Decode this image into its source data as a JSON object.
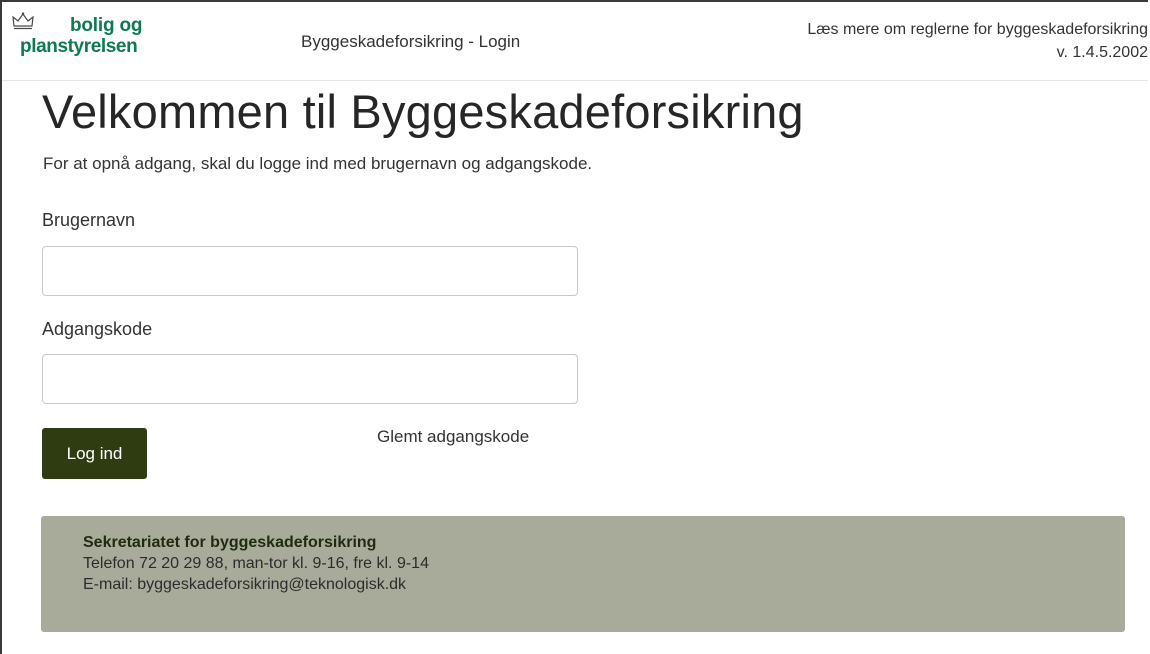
{
  "header": {
    "logo_line1": "bolig og",
    "logo_line2": "planstyrelsen",
    "app_title": "Byggeskadeforsikring - Login",
    "rules_link": "Læs mere om reglerne for byggeskadeforsikring",
    "version": "v. 1.4.5.2002"
  },
  "main": {
    "heading": "Velkommen til Byggeskadeforsikring",
    "intro": "For at opnå adgang, skal du logge ind med brugernavn og adgangskode.",
    "username_label": "Brugernavn",
    "username_value": "",
    "password_label": "Adgangskode",
    "password_value": "",
    "login_button": "Log ind",
    "forgot_link": "Glemt adgangskode"
  },
  "info": {
    "title": "Sekretariatet for byggeskadeforsikring",
    "phone": "Telefon 72 20 29 88, man-tor kl. 9-16, fre kl. 9-14",
    "email": "E-mail: byggeskadeforsikring@teknologisk.dk"
  },
  "colors": {
    "brand_green": "#0d7a4f",
    "button_bg": "#2f3c12",
    "info_bg": "#a9ab9a"
  },
  "icons": {
    "logo": "crown-icon"
  }
}
